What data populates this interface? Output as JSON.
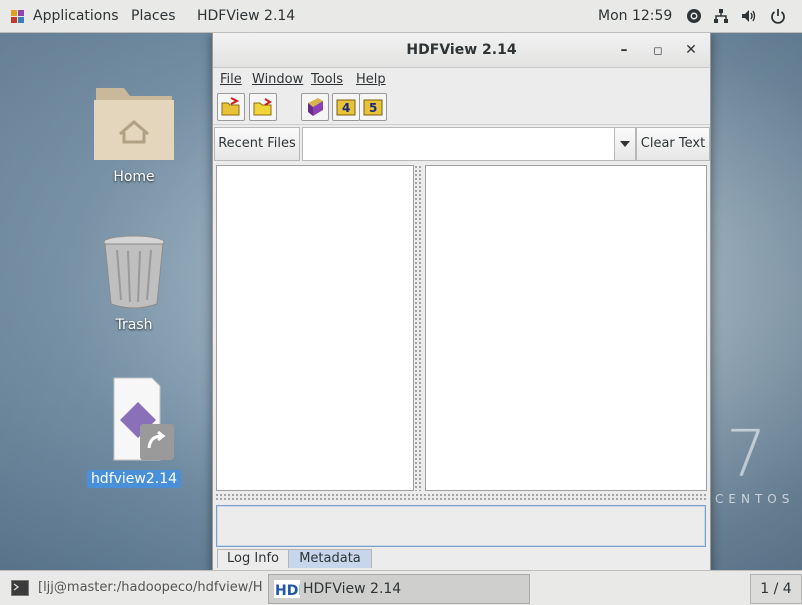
{
  "topbar": {
    "applications": "Applications",
    "places": "Places",
    "app_name": "HDFView 2.14",
    "clock": "Mon 12:59",
    "tray_icons": [
      "accessibility-icon",
      "network-icon",
      "volume-icon",
      "power-icon"
    ]
  },
  "desktop": {
    "icons": [
      {
        "label": "Home",
        "icon": "folder-home-icon"
      },
      {
        "label": "Trash",
        "icon": "trash-icon"
      },
      {
        "label": "hdfview2.14",
        "icon": "script-link-icon",
        "selected": true
      }
    ],
    "watermark_number": "7",
    "watermark_text": "CENTOS"
  },
  "window": {
    "title": "HDFView 2.14",
    "controls": [
      "minimize-icon",
      "maximize-icon",
      "close-icon"
    ],
    "menus": [
      "File",
      "Window",
      "Tools",
      "Help"
    ],
    "toolbar_icons": [
      "open-file-icon",
      "open-folder-icon",
      "users-guide-icon",
      "hdf4-library-icon",
      "hdf5-library-icon"
    ],
    "recent_files_label": "Recent Files",
    "url_value": "",
    "clear_text_label": "Clear Text",
    "log_text": "",
    "tabs": [
      "Log Info",
      "Metadata"
    ],
    "active_tab": "Log Info"
  },
  "taskbar": {
    "tasks": [
      {
        "label": "[ljj@master:/hadoopeco/hdfview/H...",
        "icon": "terminal-icon",
        "active": false
      },
      {
        "label": "HDFView 2.14",
        "icon": "hdf-icon",
        "active": true
      }
    ],
    "workspace": "1 / 4"
  },
  "colors": {
    "selection": "#4a90d9",
    "panel": "#e9e9e7",
    "window_bg": "#ececec"
  }
}
